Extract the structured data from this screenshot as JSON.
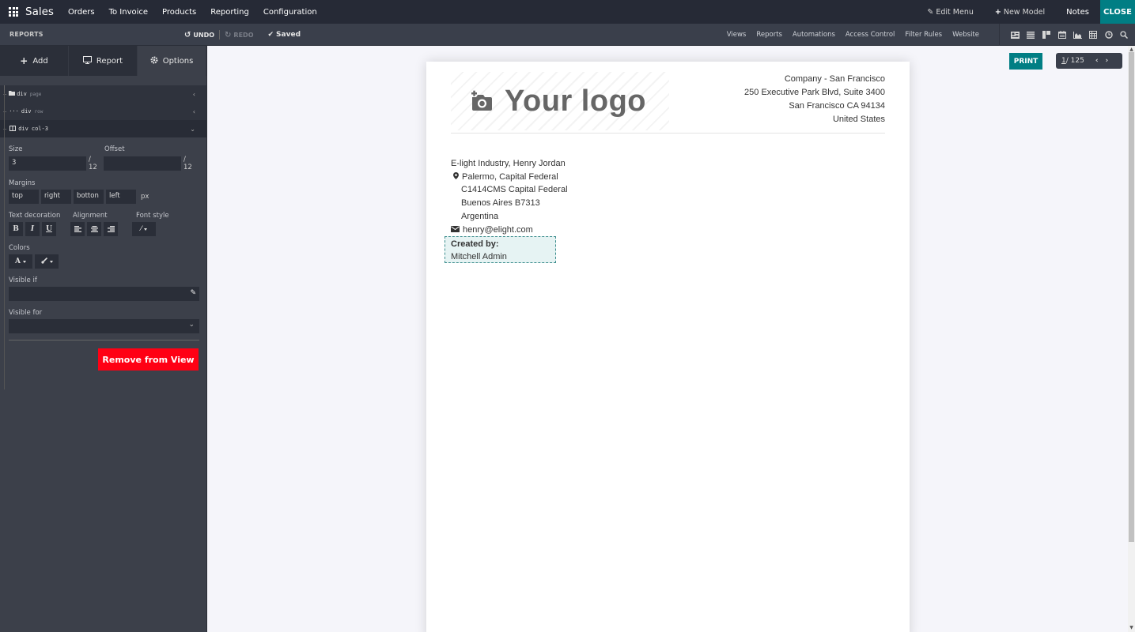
{
  "topbar": {
    "app_name": "Sales",
    "menu": [
      "Orders",
      "To Invoice",
      "Products",
      "Reporting",
      "Configuration"
    ],
    "edit_menu": "Edit Menu",
    "new_model": "New Model",
    "notes": "Notes",
    "close": "CLOSE"
  },
  "subbar": {
    "title": "REPORTS",
    "undo": "UNDO",
    "redo": "REDO",
    "saved": "Saved",
    "links": [
      "Views",
      "Reports",
      "Automations",
      "Access Control",
      "Filter Rules",
      "Website"
    ],
    "view_icons": [
      "form-view-icon",
      "list-view-icon",
      "kanban-view-icon",
      "calendar-view-icon",
      "graph-view-icon",
      "pivot-view-icon",
      "activity-view-icon",
      "search-view-icon"
    ]
  },
  "sidebar": {
    "tabs": [
      {
        "label": "Add",
        "icon": "plus-icon"
      },
      {
        "label": "Report",
        "icon": "monitor-icon"
      },
      {
        "label": "Options",
        "icon": "gear-icon",
        "active": true
      }
    ],
    "tree": [
      {
        "tag": "div",
        "class": "page",
        "icon": "folder-icon"
      },
      {
        "tag": "div",
        "class": "row",
        "icon": "ellipsis-icon"
      },
      {
        "tag": "div",
        "class": "col-3",
        "icon": "column-icon",
        "selected": true
      }
    ],
    "options": {
      "size_label": "Size",
      "size_value": "3",
      "size_suffix": "/ 12",
      "offset_label": "Offset",
      "offset_value": "",
      "offset_suffix": "/ 12",
      "margins_label": "Margins",
      "margins": [
        "top",
        "right",
        "botton",
        "left"
      ],
      "margins_unit": "px",
      "text_decoration_label": "Text decoration",
      "text_decoration": [
        "B",
        "I",
        "U"
      ],
      "alignment_label": "Alignment",
      "font_style_label": "Font style",
      "colors_label": "Colors",
      "color_text": "A",
      "visible_if_label": "Visible if",
      "visible_if_value": "",
      "visible_for_label": "Visible for",
      "visible_for_value": "",
      "remove_label": "Remove from View"
    }
  },
  "canvas": {
    "print": "PRINT",
    "pager_current": "1",
    "pager_total": "/ 125",
    "logo_text": "Your logo",
    "company": [
      "Company - San Francisco",
      "250 Executive Park Blvd, Suite 3400",
      "San Francisco CA 94134",
      "United States"
    ],
    "customer": {
      "name": "E-light Industry, Henry Jordan",
      "address": [
        "Palermo, Capital Federal",
        "C1414CMS Capital Federal",
        "Buenos Aires B7313",
        "Argentina"
      ],
      "email": "henry@elight.com"
    },
    "created_by_label": "Created by:",
    "created_by_value": "Mitchell Admin"
  }
}
